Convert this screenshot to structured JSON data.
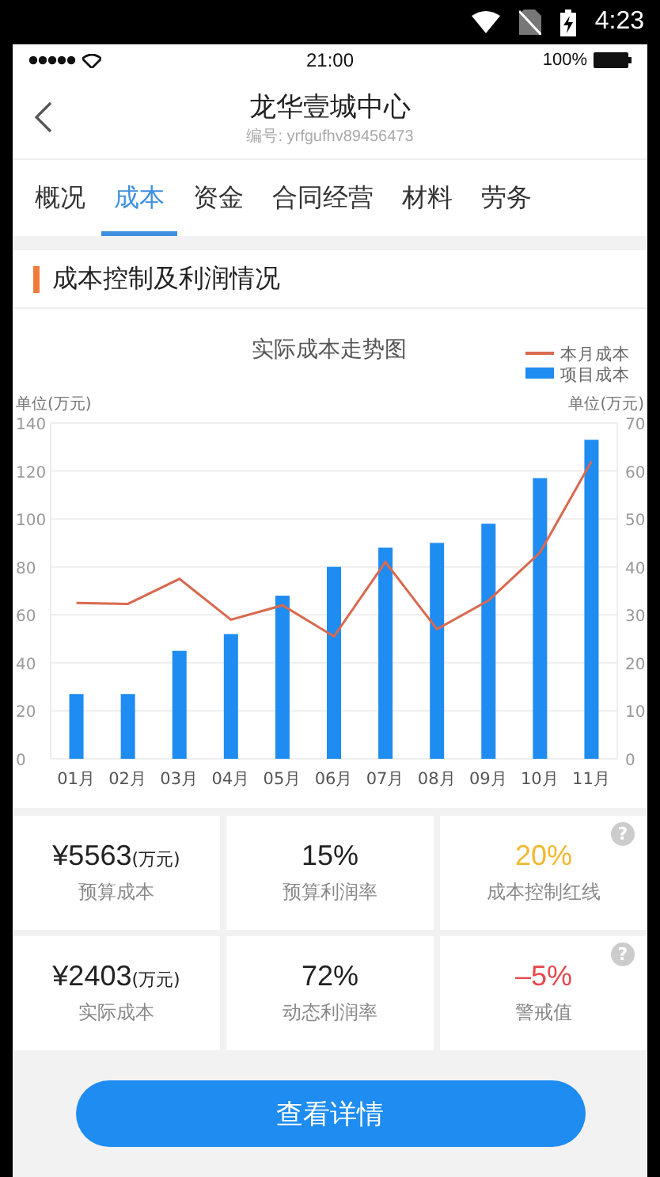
{
  "system_bar": {
    "time": "4:23"
  },
  "phone_status": {
    "time": "21:00",
    "battery": "100%"
  },
  "header": {
    "title": "龙华壹城中心",
    "code_label": "编号:",
    "code": "yrfgufhv89456473"
  },
  "tabs": [
    {
      "label": "概况",
      "selected": false
    },
    {
      "label": "成本",
      "selected": true
    },
    {
      "label": "资金",
      "selected": false
    },
    {
      "label": "合同经营",
      "selected": false
    },
    {
      "label": "材料",
      "selected": false
    },
    {
      "label": "劳务",
      "selected": false
    }
  ],
  "section": {
    "title": "成本控制及利润情况"
  },
  "chart": {
    "left_unit": "单位(万元)",
    "right_unit": "单位(万元)",
    "chart_data": {
      "type": "bar",
      "title": "实际成本走势图",
      "categories": [
        "01月",
        "02月",
        "03月",
        "04月",
        "05月",
        "06月",
        "07月",
        "08月",
        "09月",
        "10月",
        "11月"
      ],
      "series": [
        {
          "name": "项目成本",
          "type": "bar",
          "color": "#1e8cf0",
          "values": [
            27,
            27,
            45,
            52,
            68,
            80,
            88,
            90,
            98,
            117,
            133
          ]
        },
        {
          "name": "本月成本",
          "type": "line",
          "axis": "y2",
          "color": "#d9694f",
          "values": [
            32.5,
            32.3,
            37.5,
            29,
            32,
            25.5,
            41,
            27,
            33,
            43,
            62
          ]
        }
      ],
      "grid": true,
      "legend": "top-right",
      "ylim": [
        0,
        140
      ],
      "yticks": [
        0,
        20,
        40,
        60,
        80,
        100,
        120,
        140
      ],
      "y2lim": [
        0,
        70
      ],
      "y2ticks": [
        0,
        10,
        20,
        30,
        40,
        50,
        60,
        70
      ]
    }
  },
  "stats": [
    {
      "value": "¥5563",
      "unit": "(万元)",
      "label": "预算成本",
      "color": "#222222"
    },
    {
      "value": "15%",
      "label": "预算利润率",
      "color": "#222222"
    },
    {
      "value": "20%",
      "label": "成本控制红线",
      "color": "#f0b92e",
      "help": "?"
    },
    {
      "value": "¥2403",
      "unit": "(万元)",
      "label": "实际成本",
      "color": "#222222"
    },
    {
      "value": "72%",
      "label": "动态利润率",
      "color": "#222222"
    },
    {
      "value": "–5%",
      "label": "警戒值",
      "color": "#e5484d",
      "help": "?"
    }
  ],
  "button": {
    "label": "查看详情"
  }
}
